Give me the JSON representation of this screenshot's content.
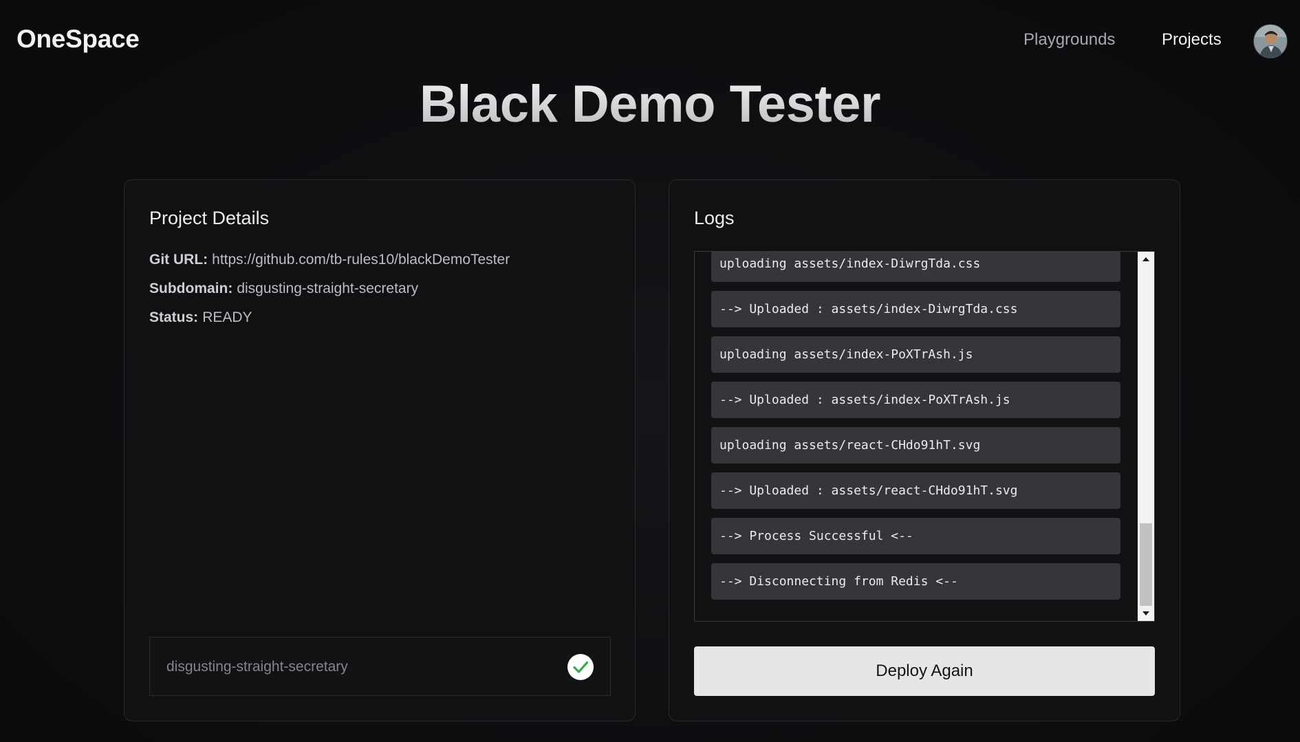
{
  "navbar": {
    "brand": "OneSpace",
    "links": [
      "Playgrounds",
      "Projects"
    ],
    "active": "Projects"
  },
  "page": {
    "title": "Black Demo Tester"
  },
  "details": {
    "title": "Project Details",
    "git_label": "Git URL:",
    "git_url": "https://github.com/tb-rules10/blackDemoTester",
    "subdomain_label": "Subdomain:",
    "subdomain": "disgusting-straight-secretary",
    "status_label": "Status:",
    "status": "READY",
    "domain_field": "disgusting-straight-secretary",
    "domain_status_icon": "check-circle-icon"
  },
  "logs": {
    "title": "Logs",
    "entries": [
      "uploading assets/index-DiwrgTda.css",
      "--> Uploaded : assets/index-DiwrgTda.css",
      "uploading assets/index-PoXTrAsh.js",
      "--> Uploaded : assets/index-PoXTrAsh.js",
      "uploading assets/react-CHdo91hT.svg",
      "--> Uploaded : assets/react-CHdo91hT.svg",
      "--> Process Successful <--",
      "--> Disconnecting from Redis <--"
    ],
    "deploy_label": "Deploy Again"
  },
  "colors": {
    "background": "#0d0d0f",
    "card": "#111114",
    "log_item": "#35353a",
    "check": "#3aa84a"
  }
}
